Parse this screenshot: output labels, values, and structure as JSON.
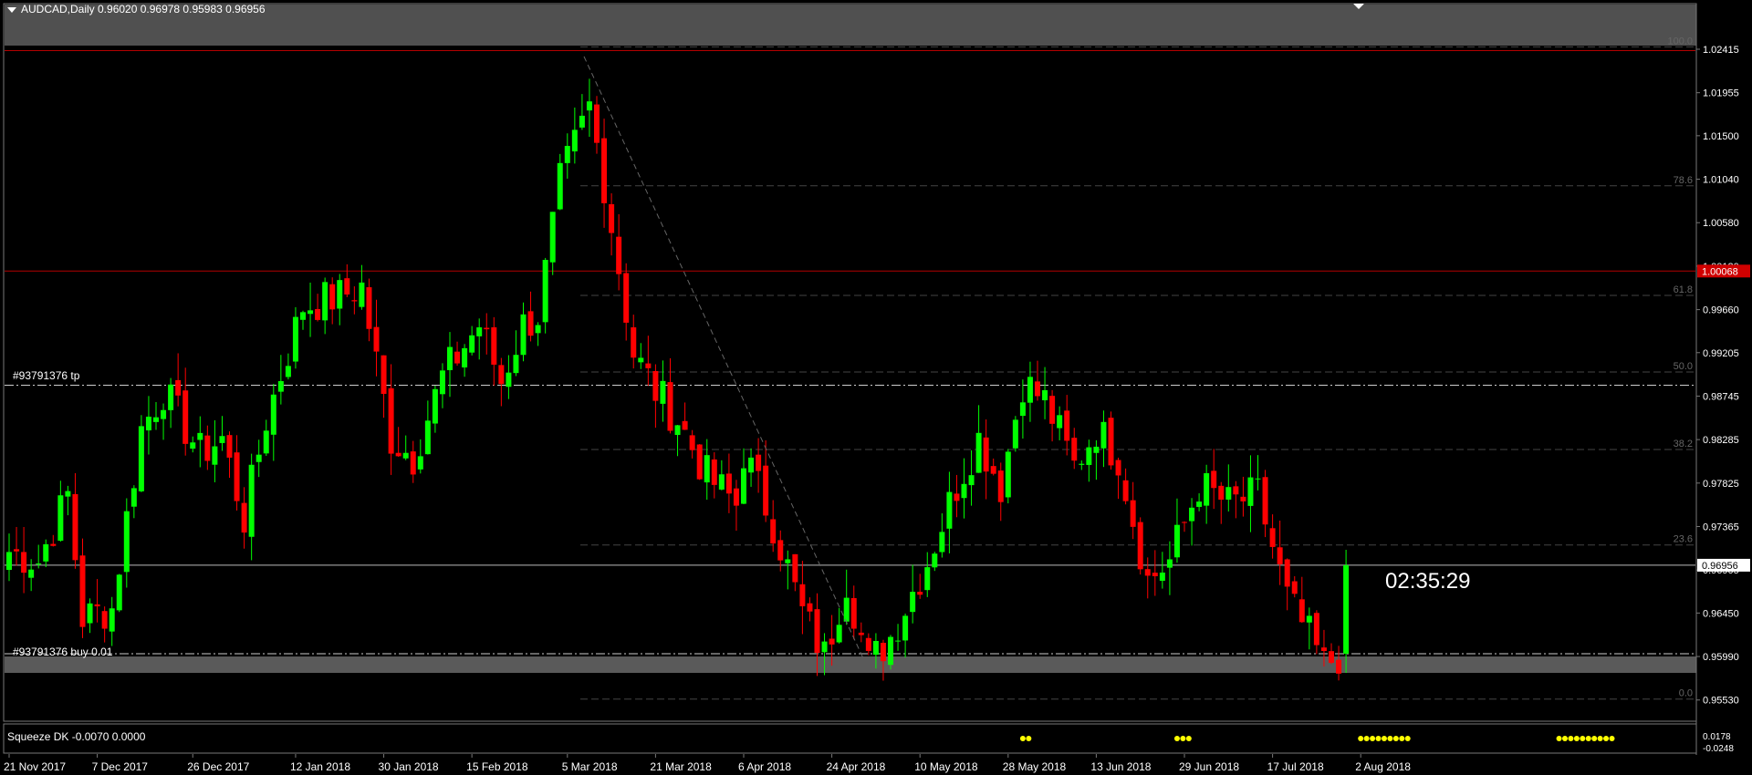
{
  "window": {
    "symbol_header": "AUDCAD,Daily  0.96020 0.96978 0.95983 0.96956"
  },
  "orders": {
    "tp_label": "#93791376 tp",
    "entry_label": "#93791376 buy 0.01"
  },
  "timer": "02:35:29",
  "indicator": {
    "label": "Squeeze DK -0.0070 0.0000",
    "axis_top": "0.0178",
    "axis_bottom": "-0.0248",
    "dot_color": "#ffff00",
    "dot_groups": [
      {
        "start_index": 138,
        "count": 2
      },
      {
        "start_index": 159,
        "count": 3
      },
      {
        "start_index": 184,
        "count": 9
      },
      {
        "start_index": 211,
        "count": 10
      }
    ]
  },
  "price_axis": {
    "ticks": [
      "1.02415",
      "1.01955",
      "1.01500",
      "1.01040",
      "1.00580",
      "1.00120",
      "0.99660",
      "0.99205",
      "0.98745",
      "0.98285",
      "0.97825",
      "0.97365",
      "0.96905",
      "0.96450",
      "0.95990",
      "0.95530"
    ],
    "current_price": "0.96956",
    "alert_price": "1.00068"
  },
  "fibonacci": {
    "levels": [
      {
        "label": "100.0",
        "price": 1.0244
      },
      {
        "label": "78.6",
        "price": 1.0097
      },
      {
        "label": "61.8",
        "price": 0.9981
      },
      {
        "label": "50.0",
        "price": 0.99
      },
      {
        "label": "38.2",
        "price": 0.9818
      },
      {
        "label": "23.6",
        "price": 0.9717
      },
      {
        "label": "0.0",
        "price": 0.9554
      }
    ]
  },
  "horizontal_lines": {
    "resistance_top": 1.024,
    "resistance_mid": 1.00068,
    "tp": 0.9886,
    "entry": 0.9602,
    "current": 0.96956
  },
  "date_axis": {
    "labels": [
      {
        "text": "21 Nov 2017",
        "index": 0
      },
      {
        "text": "7 Dec 2017",
        "index": 12
      },
      {
        "text": "26 Dec 2017",
        "index": 25
      },
      {
        "text": "12 Jan 2018",
        "index": 39
      },
      {
        "text": "30 Jan 2018",
        "index": 51
      },
      {
        "text": "15 Feb 2018",
        "index": 63
      },
      {
        "text": "5 Mar 2018",
        "index": 76
      },
      {
        "text": "21 Mar 2018",
        "index": 88
      },
      {
        "text": "6 Apr 2018",
        "index": 100
      },
      {
        "text": "24 Apr 2018",
        "index": 112
      },
      {
        "text": "10 May 2018",
        "index": 124
      },
      {
        "text": "28 May 2018",
        "index": 136
      },
      {
        "text": "13 Jun 2018",
        "index": 148
      },
      {
        "text": "29 Jun 2018",
        "index": 160
      },
      {
        "text": "17 Jul 2018",
        "index": 172
      },
      {
        "text": "2 Aug 2018",
        "index": 184
      }
    ]
  },
  "colors": {
    "background": "#000000",
    "bull": "#00ff00",
    "bear": "#ff0000",
    "resistance": "#b40000",
    "grid": "#555555",
    "zone": "#5a5a5a"
  },
  "chart_data": {
    "type": "candlestick",
    "title": "AUDCAD,Daily",
    "xlabel": "",
    "ylabel": "",
    "ylim": [
      0.9546,
      1.0255
    ],
    "waypoints": [
      {
        "index": 0,
        "close": 0.971
      },
      {
        "index": 4,
        "close": 0.97
      },
      {
        "index": 8,
        "close": 0.977
      },
      {
        "index": 10,
        "close": 0.964
      },
      {
        "index": 14,
        "close": 0.965
      },
      {
        "index": 18,
        "close": 0.984
      },
      {
        "index": 21,
        "close": 0.988
      },
      {
        "index": 26,
        "close": 0.9815
      },
      {
        "index": 29,
        "close": 0.983
      },
      {
        "index": 32,
        "close": 0.9745
      },
      {
        "index": 35,
        "close": 0.985
      },
      {
        "index": 40,
        "close": 0.997
      },
      {
        "index": 45,
        "close": 0.998
      },
      {
        "index": 48,
        "close": 0.999
      },
      {
        "index": 52,
        "close": 0.983
      },
      {
        "index": 55,
        "close": 0.981
      },
      {
        "index": 59,
        "close": 0.9895
      },
      {
        "index": 64,
        "close": 0.995
      },
      {
        "index": 67,
        "close": 0.989
      },
      {
        "index": 70,
        "close": 0.995
      },
      {
        "index": 72,
        "close": 0.996
      },
      {
        "index": 75,
        "close": 1.01
      },
      {
        "index": 79,
        "close": 1.018
      },
      {
        "index": 81,
        "close": 1.01
      },
      {
        "index": 85,
        "close": 0.992
      },
      {
        "index": 88,
        "close": 0.988
      },
      {
        "index": 91,
        "close": 0.985
      },
      {
        "index": 95,
        "close": 0.979
      },
      {
        "index": 99,
        "close": 0.976
      },
      {
        "index": 100,
        "close": 0.9815
      },
      {
        "index": 104,
        "close": 0.974
      },
      {
        "index": 108,
        "close": 0.9645
      },
      {
        "index": 111,
        "close": 0.96
      },
      {
        "index": 114,
        "close": 0.968
      },
      {
        "index": 117,
        "close": 0.959
      },
      {
        "index": 120,
        "close": 0.962
      },
      {
        "index": 125,
        "close": 0.97
      },
      {
        "index": 129,
        "close": 0.978
      },
      {
        "index": 132,
        "close": 0.983
      },
      {
        "index": 135,
        "close": 0.978
      },
      {
        "index": 138,
        "close": 0.989
      },
      {
        "index": 141,
        "close": 0.987
      },
      {
        "index": 145,
        "close": 0.98
      },
      {
        "index": 148,
        "close": 0.984
      },
      {
        "index": 151,
        "close": 0.981
      },
      {
        "index": 155,
        "close": 0.968
      },
      {
        "index": 158,
        "close": 0.97
      },
      {
        "index": 162,
        "close": 0.978
      },
      {
        "index": 166,
        "close": 0.976
      },
      {
        "index": 170,
        "close": 0.977
      },
      {
        "index": 174,
        "close": 0.966
      },
      {
        "index": 177,
        "close": 0.962
      },
      {
        "index": 179,
        "close": 0.959
      },
      {
        "index": 181,
        "close": 0.96
      },
      {
        "index": 182,
        "close": 0.96956
      }
    ],
    "candle_count": 183
  }
}
